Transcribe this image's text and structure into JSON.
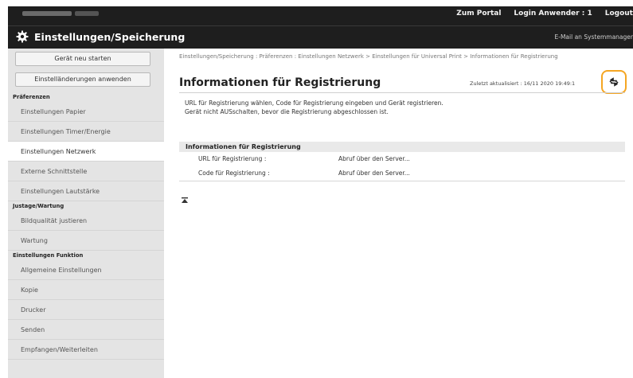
{
  "header": {
    "portal_link": "Zum Portal",
    "login_label": "Login Anwender :",
    "login_count": "1",
    "logout_link": "Logout",
    "app_title": "Einstellungen/Speicherung",
    "mail_link": "E-Mail an Systemmanager"
  },
  "sidebar": {
    "restart_button": "Gerät neu starten",
    "apply_button": "Einstelländerungen anwenden",
    "sections": [
      {
        "heading": "Präferenzen",
        "items": [
          {
            "label": "Einstellungen Papier",
            "active": false
          },
          {
            "label": "Einstellungen Timer/Energie",
            "active": false
          },
          {
            "label": "Einstellungen Netzwerk",
            "active": true
          },
          {
            "label": "Externe Schnittstelle",
            "active": false
          },
          {
            "label": "Einstellungen Lautstärke",
            "active": false
          }
        ]
      },
      {
        "heading": "Justage/Wartung",
        "items": [
          {
            "label": "Bildqualität justieren",
            "active": false
          },
          {
            "label": "Wartung",
            "active": false
          }
        ]
      },
      {
        "heading": "Einstellungen Funktion",
        "items": [
          {
            "label": "Allgemeine Einstellungen",
            "active": false
          },
          {
            "label": "Kopie",
            "active": false
          },
          {
            "label": "Drucker",
            "active": false
          },
          {
            "label": "Senden",
            "active": false
          },
          {
            "label": "Empfangen/Weiterleiten",
            "active": false
          }
        ]
      }
    ]
  },
  "main": {
    "breadcrumb": "Einstellungen/Speicherung : Präferenzen : Einstellungen Netzwerk > Einstellungen für Universal Print > Informationen für Registrierung",
    "title": "Informationen für Registrierung",
    "updated": "Zuletzt aktualisiert : 16/11 2020 19:49:1",
    "description_line1": "URL für Registrierung wählen, Code für Registrierung eingeben und Gerät registrieren.",
    "description_line2": "Gerät nicht AUSschalten, bevor die Registrierung abgeschlossen ist.",
    "panel": {
      "heading": "Informationen für Registrierung",
      "rows": [
        {
          "label": "URL für Registrierung :",
          "value": "Abruf über den Server..."
        },
        {
          "label": "Code für Registrierung :",
          "value": "Abruf über den Server..."
        }
      ]
    }
  },
  "colors": {
    "header_bg": "#1e1e1e",
    "sidebar_bg": "#e4e4e4",
    "highlight": "#f5a623"
  },
  "icons": {
    "settings": "gear-icon",
    "refresh": "refresh-icon",
    "page_top": "page-top-icon"
  }
}
